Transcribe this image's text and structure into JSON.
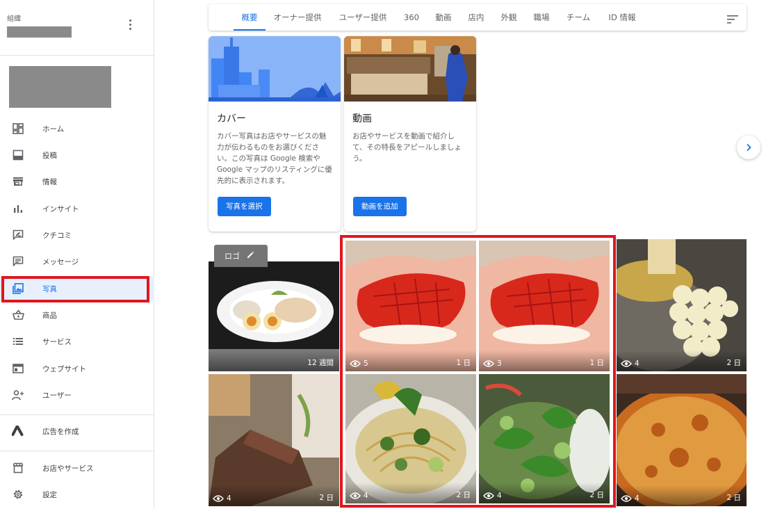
{
  "sidebar": {
    "org_label": "組織",
    "items": [
      {
        "label": "ホーム",
        "icon": "dashboard-icon"
      },
      {
        "label": "投稿",
        "icon": "post-icon"
      },
      {
        "label": "情報",
        "icon": "storefront-icon"
      },
      {
        "label": "インサイト",
        "icon": "bar-chart-icon"
      },
      {
        "label": "クチコミ",
        "icon": "review-icon"
      },
      {
        "label": "メッセージ",
        "icon": "message-icon"
      },
      {
        "label": "写真",
        "icon": "photo-icon",
        "active": true
      },
      {
        "label": "商品",
        "icon": "basket-icon"
      },
      {
        "label": "サービス",
        "icon": "list-icon"
      },
      {
        "label": "ウェブサイト",
        "icon": "website-icon"
      },
      {
        "label": "ユーザー",
        "icon": "add-user-icon"
      },
      {
        "label": "広告を作成",
        "icon": "google-ads-icon"
      },
      {
        "label": "お店やサービス",
        "icon": "store-icon"
      },
      {
        "label": "設定",
        "icon": "gear-icon"
      }
    ]
  },
  "tabs": [
    "概要",
    "オーナー提供",
    "ユーザー提供",
    "360",
    "動画",
    "店内",
    "外観",
    "職場",
    "チーム",
    "ID 情報"
  ],
  "active_tab": "概要",
  "cards": [
    {
      "title": "カバー",
      "description": "カバー写真はお店やサービスの魅力が伝わるものをお選びください。この写真は Google 検索や Google マップのリスティングに優先的に表示されます。",
      "button": "写真を選択"
    },
    {
      "title": "動画",
      "description": "お店やサービスを動画で紹介して、その特長をアピールしましょう。",
      "button": "動画を追加"
    }
  ],
  "logo_chip": "ロゴ",
  "photos": [
    {
      "views": "",
      "age": "12 週間"
    },
    {
      "views": "5",
      "age": "1 日"
    },
    {
      "views": "3",
      "age": "1 日"
    },
    {
      "views": "4",
      "age": "2 日"
    },
    {
      "views": "4",
      "age": "2 日"
    },
    {
      "views": "4",
      "age": "2 日"
    },
    {
      "views": "4",
      "age": "2 日"
    },
    {
      "views": "4",
      "age": "2 日"
    }
  ],
  "colors": {
    "accent": "#1a73e8",
    "highlight_red": "#e0161e"
  }
}
